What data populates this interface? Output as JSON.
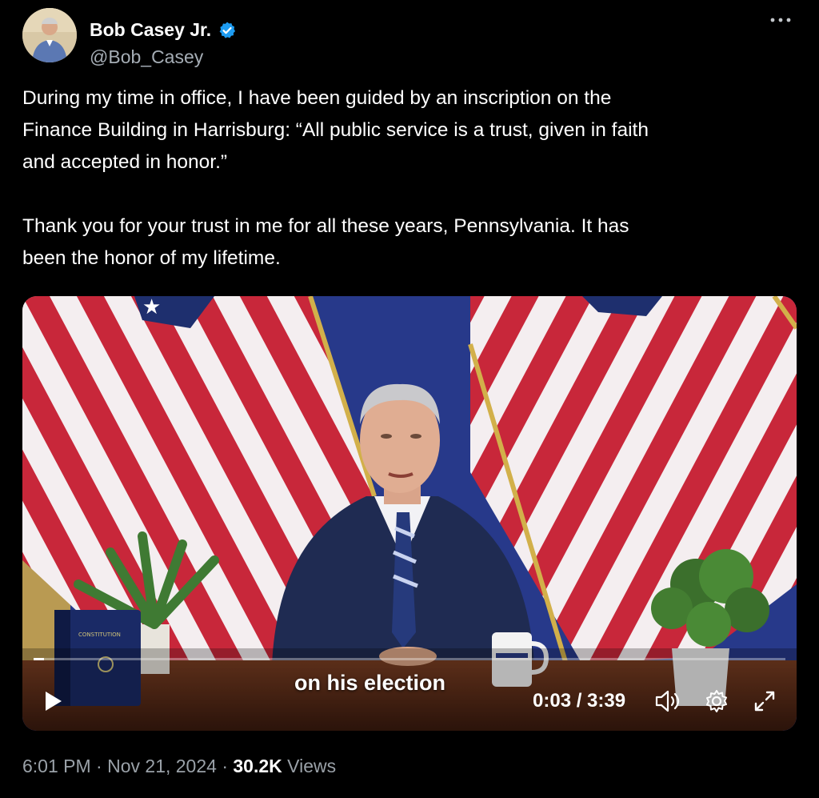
{
  "author": {
    "display_name": "Bob Casey Jr.",
    "handle": "@Bob_Casey",
    "verified_icon": "verified-badge-icon"
  },
  "more_icon": "more-horizontal-icon",
  "tweet": {
    "text": "During my time in office, I have been guided by an inscription on the\nFinance Building in Harrisburg: “All public service is a trust, given in faith\nand accepted in honor.”\n\nThank you for your trust in me for all these years, Pennsylvania. It has\nbeen the honor of my lifetime."
  },
  "video": {
    "caption": "on his election",
    "time": "0:03 / 3:39",
    "progress": 0.014,
    "play_icon": "play-icon",
    "volume_icon": "volume-icon",
    "settings_icon": "gear-icon",
    "fullscreen_icon": "expand-icon",
    "book_title": "CONSTITUTION"
  },
  "meta": {
    "time": "6:01 PM",
    "sep1": "·",
    "date": "Nov 21, 2024",
    "sep2": "·",
    "views_count": "30.2K",
    "views_label": "Views"
  },
  "colors": {
    "background": "#000000",
    "verified": "#1d9bf0",
    "flag_red": "#c8273a",
    "flag_blue": "#1e2f6e"
  }
}
